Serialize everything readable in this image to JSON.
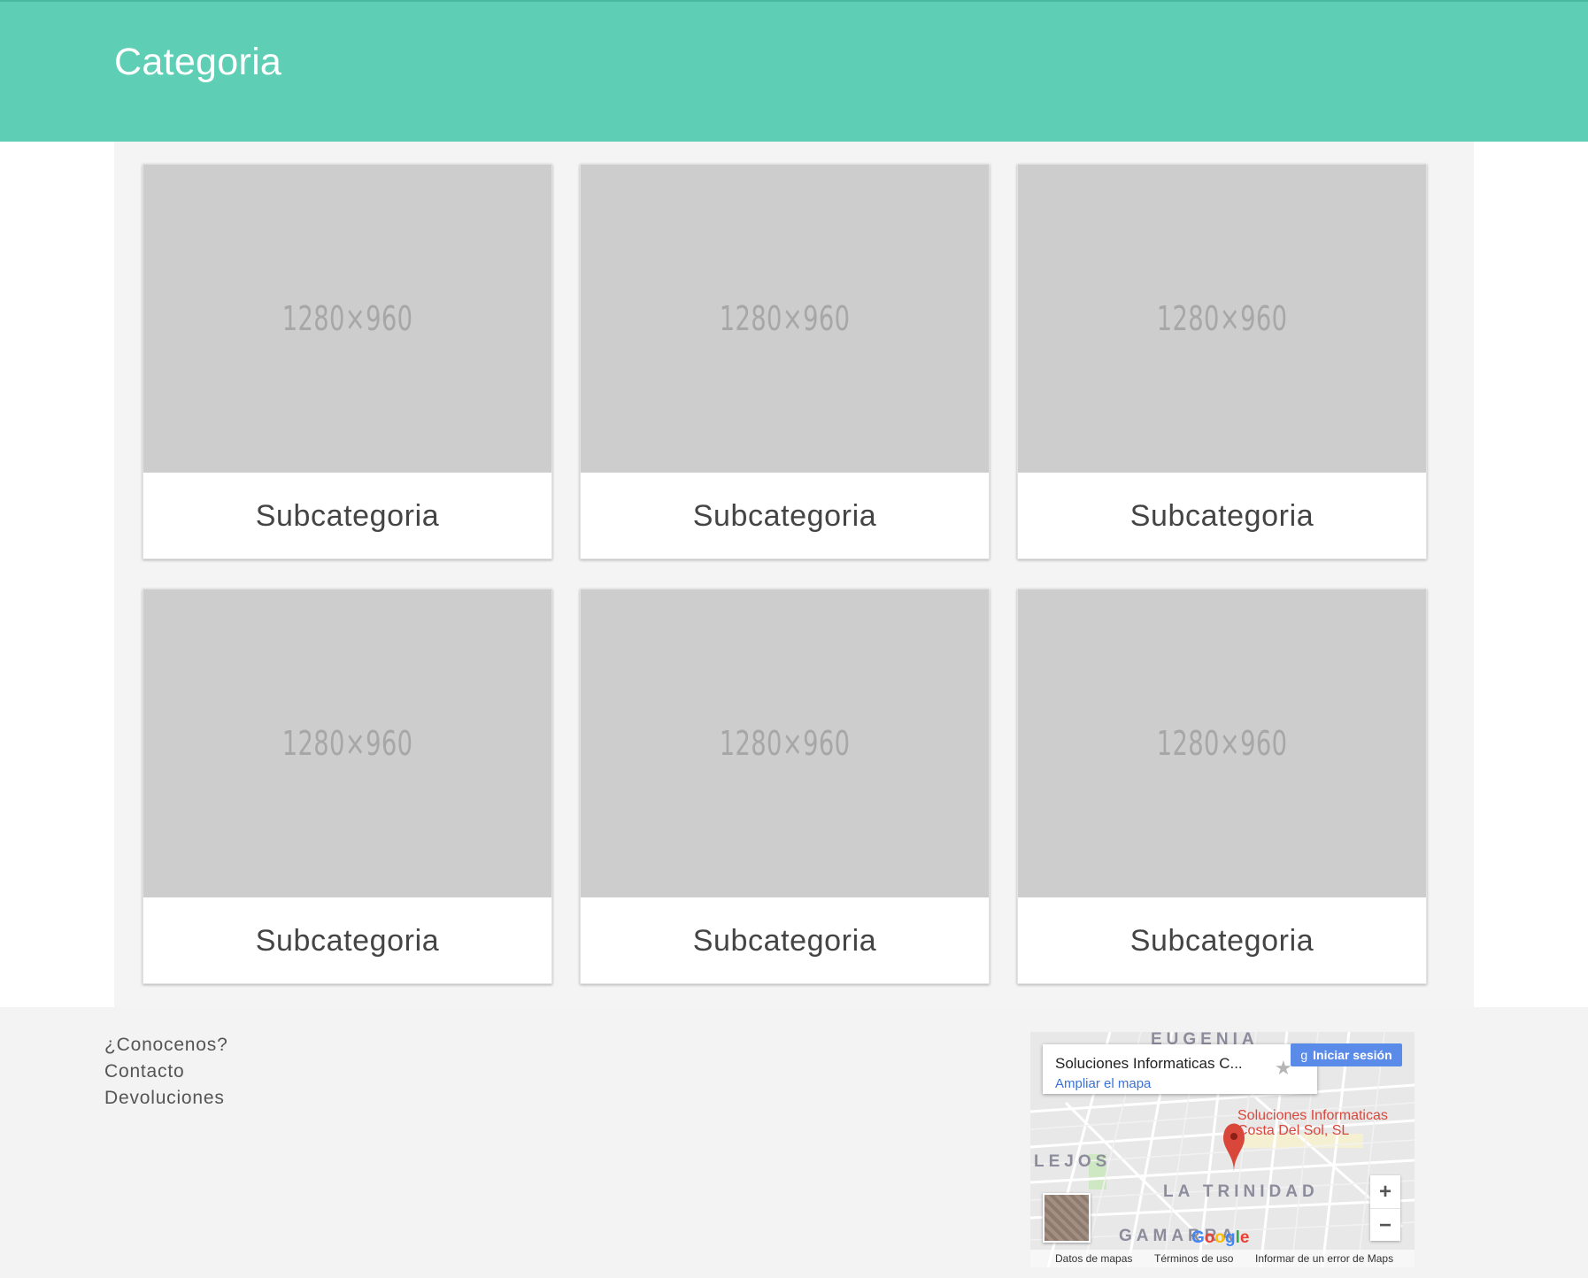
{
  "header": {
    "title": "Categoria"
  },
  "cards": [
    {
      "placeholder": "1280×960",
      "label": "Subcategoria"
    },
    {
      "placeholder": "1280×960",
      "label": "Subcategoria"
    },
    {
      "placeholder": "1280×960",
      "label": "Subcategoria"
    },
    {
      "placeholder": "1280×960",
      "label": "Subcategoria"
    },
    {
      "placeholder": "1280×960",
      "label": "Subcategoria"
    },
    {
      "placeholder": "1280×960",
      "label": "Subcategoria"
    }
  ],
  "footer": {
    "links": [
      "¿Conocenos?",
      "Contacto",
      "Devoluciones"
    ]
  },
  "map": {
    "place_name": "Soluciones Informaticas C...",
    "enlarge_link": "Ampliar el mapa",
    "signin_button": "Iniciar sesión",
    "pin_label_line1": "Soluciones Informaticas",
    "pin_label_line2": "Costa Del Sol, SL",
    "districts": [
      "EUGENIA",
      "LEJOS",
      "LA TRINIDAD",
      "GAMARRA"
    ],
    "zoom_in": "+",
    "zoom_out": "−",
    "google_logo": "Google",
    "footer_links": [
      "Datos de mapas",
      "Términos de uso",
      "Informar de un error de Maps"
    ],
    "icons": [
      "map-pin-icon",
      "star-icon",
      "google-g-icon"
    ]
  },
  "colors": {
    "header_bg": "#5ecfb5",
    "content_bg": "#f4f4f4",
    "placeholder_bg": "#cdcdcd",
    "pin_red": "#d9473b",
    "link_blue": "#3a72d8"
  }
}
